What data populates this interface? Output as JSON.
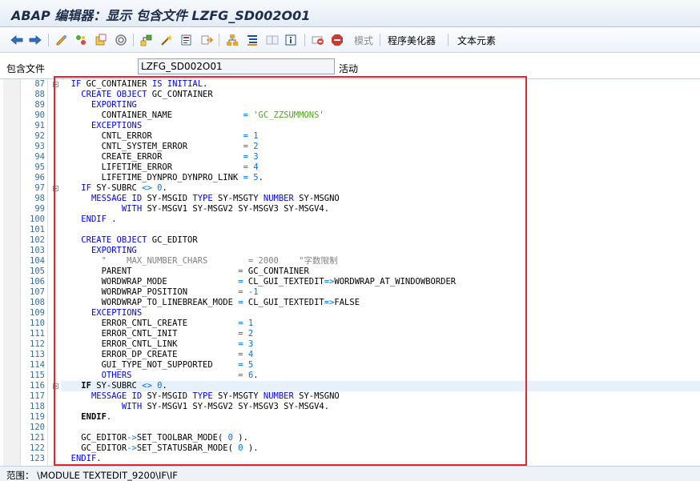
{
  "window": {
    "title": "ABAP 编辑器：显示 包含文件 LZFG_SD002O01"
  },
  "toolbar": {
    "icons": [
      "back-icon",
      "forward-icon",
      "display-change-icon",
      "activate-icon",
      "check-icon",
      "where-used-icon",
      "object-list-icon",
      "wand-icon",
      "enhance-icon",
      "navigate-icon",
      "hierarchy-icon",
      "pretty-printer-icon",
      "split-editor-icon",
      "info-icon",
      "pattern-icon",
      "stop-icon"
    ],
    "mode_label": "模式",
    "pretty_printer_label": "程序美化器",
    "text_elements_label": "文本元素"
  },
  "infobar": {
    "include_label": "包含文件",
    "include_name": "LZFG_SD002O01",
    "status": "活动"
  },
  "editor": {
    "line_numbers": [
      "87",
      "88",
      "89",
      "90",
      "91",
      "92",
      "93",
      "94",
      "95",
      "96",
      "97",
      "98",
      "99",
      "100",
      "101",
      "102",
      "103",
      "104",
      "105",
      "106",
      "107",
      "108",
      "109",
      "110",
      "111",
      "112",
      "113",
      "114",
      "115",
      "116",
      "117",
      "118",
      "119",
      "120",
      "121",
      "122",
      "123"
    ],
    "current_line": "116",
    "lines": [
      [
        [
          "  ",
          ""
        ],
        [
          "IF",
          "kw"
        ],
        [
          " GC_CONTAINER ",
          ""
        ],
        [
          "IS INITIAL",
          "kw"
        ],
        [
          ".",
          ""
        ]
      ],
      [
        [
          "    ",
          ""
        ],
        [
          "CREATE OBJECT",
          "kw"
        ],
        [
          " GC_CONTAINER",
          ""
        ]
      ],
      [
        [
          "      ",
          ""
        ],
        [
          "EXPORTING",
          "kw"
        ]
      ],
      [
        [
          "        CONTAINER_NAME              ",
          ""
        ],
        [
          "=",
          "op"
        ],
        [
          " ",
          ""
        ],
        [
          "'GC_ZZSUMMONS'",
          "str"
        ]
      ],
      [
        [
          "      ",
          ""
        ],
        [
          "EXCEPTIONS",
          "kw"
        ]
      ],
      [
        [
          "        CNTL_ERROR                  ",
          ""
        ],
        [
          "=",
          "op"
        ],
        [
          " ",
          ""
        ],
        [
          "1",
          "num"
        ]
      ],
      [
        [
          "        CNTL_SYSTEM_ERROR           ",
          ""
        ],
        [
          "=",
          "op"
        ],
        [
          " ",
          ""
        ],
        [
          "2",
          "num"
        ]
      ],
      [
        [
          "        CREATE_ERROR                ",
          ""
        ],
        [
          "=",
          "op"
        ],
        [
          " ",
          ""
        ],
        [
          "3",
          "num"
        ]
      ],
      [
        [
          "        LIFETIME_ERROR              ",
          ""
        ],
        [
          "=",
          "op"
        ],
        [
          " ",
          ""
        ],
        [
          "4",
          "num"
        ]
      ],
      [
        [
          "        LIFETIME_DYNPRO_DYNPRO_LINK ",
          ""
        ],
        [
          "=",
          "op"
        ],
        [
          " ",
          ""
        ],
        [
          "5",
          "num"
        ],
        [
          ".",
          ""
        ]
      ],
      [
        [
          "    ",
          ""
        ],
        [
          "IF",
          "kw"
        ],
        [
          " SY-SUBRC ",
          ""
        ],
        [
          "<>",
          "op"
        ],
        [
          " ",
          ""
        ],
        [
          "0",
          "num"
        ],
        [
          ".",
          ""
        ]
      ],
      [
        [
          "      ",
          ""
        ],
        [
          "MESSAGE ID",
          "kw"
        ],
        [
          " SY-MSGID ",
          ""
        ],
        [
          "TYPE",
          "kw"
        ],
        [
          " SY-MSGTY ",
          ""
        ],
        [
          "NUMBER",
          "kw"
        ],
        [
          " SY-MSGNO",
          ""
        ]
      ],
      [
        [
          "            ",
          ""
        ],
        [
          "WITH",
          "kw"
        ],
        [
          " SY-MSGV1 SY-MSGV2 SY-MSGV3 SY-MSGV4.",
          ""
        ]
      ],
      [
        [
          "    ",
          ""
        ],
        [
          "ENDIF",
          "kw"
        ],
        [
          " .",
          ""
        ]
      ],
      [
        [
          "",
          ""
        ]
      ],
      [
        [
          "    ",
          ""
        ],
        [
          "CREATE OBJECT",
          "kw"
        ],
        [
          " GC_EDITOR",
          ""
        ]
      ],
      [
        [
          "      ",
          ""
        ],
        [
          "EXPORTING",
          "kw"
        ]
      ],
      [
        [
          "        ",
          ""
        ],
        [
          "\"    MAX_NUMBER_CHARS        = 2000    \"字数限制",
          "cmt"
        ]
      ],
      [
        [
          "        PARENT                     ",
          ""
        ],
        [
          "=",
          "op"
        ],
        [
          " GC_CONTAINER",
          ""
        ]
      ],
      [
        [
          "        WORDWRAP_MODE              ",
          ""
        ],
        [
          "=",
          "op"
        ],
        [
          " CL_GUI_TEXTEDIT",
          ""
        ],
        [
          "=>",
          "op"
        ],
        [
          "WORDWRAP_AT_WINDOWBORDER",
          ""
        ]
      ],
      [
        [
          "        WORDWRAP_POSITION          ",
          ""
        ],
        [
          "=",
          "op"
        ],
        [
          " ",
          ""
        ],
        [
          "-1",
          "num"
        ]
      ],
      [
        [
          "        WORDWRAP_TO_LINEBREAK_MODE ",
          ""
        ],
        [
          "=",
          "op"
        ],
        [
          " CL_GUI_TEXTEDIT",
          ""
        ],
        [
          "=>",
          "op"
        ],
        [
          "FALSE",
          ""
        ]
      ],
      [
        [
          "      ",
          ""
        ],
        [
          "EXCEPTIONS",
          "kw"
        ]
      ],
      [
        [
          "        ERROR_CNTL_CREATE          ",
          ""
        ],
        [
          "=",
          "op"
        ],
        [
          " ",
          ""
        ],
        [
          "1",
          "num"
        ]
      ],
      [
        [
          "        ERROR_CNTL_INIT            ",
          ""
        ],
        [
          "=",
          "op"
        ],
        [
          " ",
          ""
        ],
        [
          "2",
          "num"
        ]
      ],
      [
        [
          "        ERROR_CNTL_LINK            ",
          ""
        ],
        [
          "=",
          "op"
        ],
        [
          " ",
          ""
        ],
        [
          "3",
          "num"
        ]
      ],
      [
        [
          "        ERROR_DP_CREATE            ",
          ""
        ],
        [
          "=",
          "op"
        ],
        [
          " ",
          ""
        ],
        [
          "4",
          "num"
        ]
      ],
      [
        [
          "        GUI_TYPE_NOT_SUPPORTED     ",
          ""
        ],
        [
          "=",
          "op"
        ],
        [
          " ",
          ""
        ],
        [
          "5",
          "num"
        ]
      ],
      [
        [
          "        ",
          ""
        ],
        [
          "OTHERS",
          "kw"
        ],
        [
          "                     ",
          ""
        ],
        [
          "=",
          "op"
        ],
        [
          " ",
          ""
        ],
        [
          "6",
          "num"
        ],
        [
          ".",
          ""
        ]
      ],
      [
        [
          "    ",
          ""
        ],
        [
          "IF",
          "kwb"
        ],
        [
          " SY-SUBRC ",
          ""
        ],
        [
          "<>",
          "op"
        ],
        [
          " ",
          ""
        ],
        [
          "0",
          "num"
        ],
        [
          ".",
          ""
        ]
      ],
      [
        [
          "      ",
          ""
        ],
        [
          "MESSAGE ID",
          "kw"
        ],
        [
          " SY-MSGID ",
          ""
        ],
        [
          "TYPE",
          "kw"
        ],
        [
          " SY-MSGTY ",
          ""
        ],
        [
          "NUMBER",
          "kw"
        ],
        [
          " SY-MSGNO",
          ""
        ]
      ],
      [
        [
          "            ",
          ""
        ],
        [
          "WITH",
          "kw"
        ],
        [
          " SY-MSGV1 SY-MSGV2 SY-MSGV3 SY-MSGV4.",
          ""
        ]
      ],
      [
        [
          "    ",
          ""
        ],
        [
          "ENDIF",
          "kwb"
        ],
        [
          ".",
          ""
        ]
      ],
      [
        [
          "",
          ""
        ]
      ],
      [
        [
          "    GC_EDITOR",
          ""
        ],
        [
          "->",
          "op"
        ],
        [
          "SET_TOOLBAR_MODE( ",
          ""
        ],
        [
          "0",
          "num"
        ],
        [
          " ).",
          ""
        ]
      ],
      [
        [
          "    GC_EDITOR",
          ""
        ],
        [
          "->",
          "op"
        ],
        [
          "SET_STATUSBAR_MODE( ",
          ""
        ],
        [
          "0",
          "num"
        ],
        [
          " ).",
          ""
        ]
      ],
      [
        [
          "  ",
          ""
        ],
        [
          "ENDIF",
          "kw"
        ],
        [
          ".",
          ""
        ]
      ]
    ]
  },
  "statusbar": {
    "scope": "范围： \\MODULE TEXTEDIT_9200\\IF\\IF"
  },
  "colors": {
    "keyword": "#0000ff",
    "string": "#4da616",
    "number": "#0070ff",
    "comment": "#808080",
    "highlight_box": "#e8242a",
    "line_number": "#3c6d9a"
  }
}
